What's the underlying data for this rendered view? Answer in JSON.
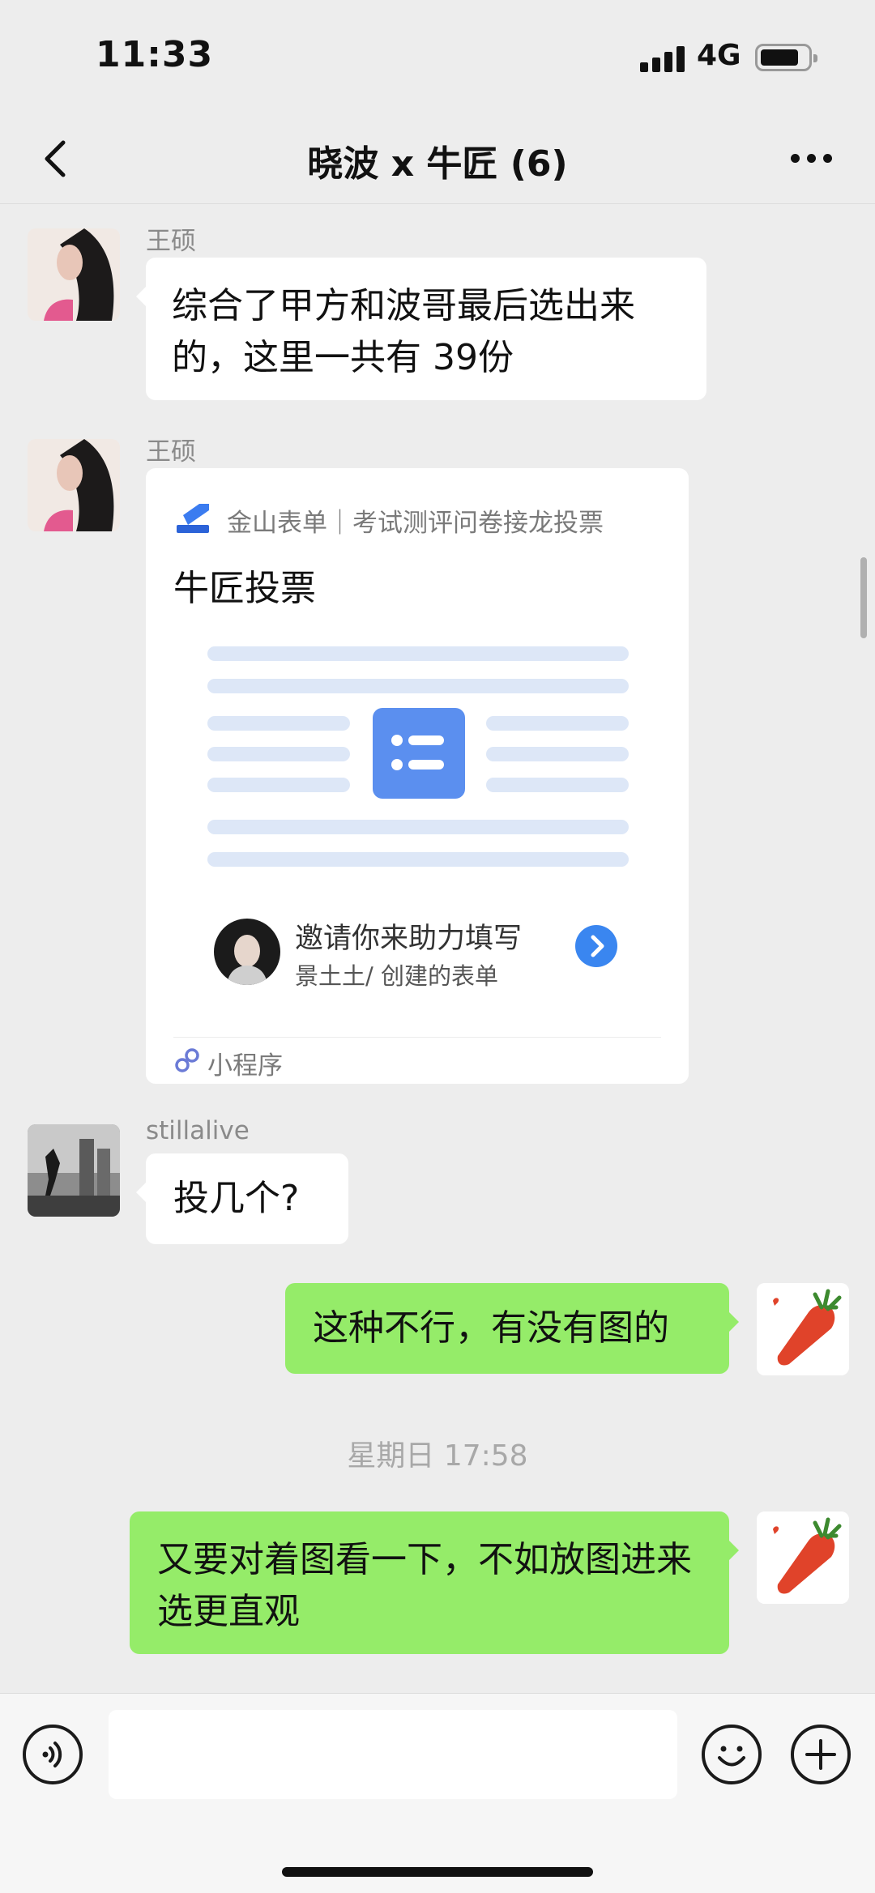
{
  "status": {
    "time": "11:33",
    "network": "4G"
  },
  "header": {
    "title": "晓波 x 牛匠 (6)"
  },
  "messages": [
    {
      "sender": "王硕",
      "text": "综合了甲方和波哥最后选出来的，这里一共有 39份"
    },
    {
      "sender": "王硕",
      "card": {
        "source": "金山表单｜考试测评问卷接龙投票",
        "title": "牛匠投票",
        "invite": "邀请你来助力填写",
        "creator": "景土土/ 创建的表单",
        "footer": "小程序"
      }
    },
    {
      "sender": "stillalive",
      "text": "投几个?"
    },
    {
      "text": "这种不行，有没有图的"
    },
    {
      "timestamp": "星期日 17:58"
    },
    {
      "text": "又要对着图看一下，不如放图进来选更直观"
    }
  ],
  "colors": {
    "background": "#ededed",
    "incoming_bubble": "#ffffff",
    "outgoing_bubble": "#95ec69",
    "card_accent": "#5b8fef",
    "link_blue": "#3a86f0"
  },
  "icons": {
    "back": "chevron-left-icon",
    "more": "more-dots-icon",
    "voice": "voice-icon",
    "emoji": "emoji-icon",
    "plus": "plus-icon"
  }
}
